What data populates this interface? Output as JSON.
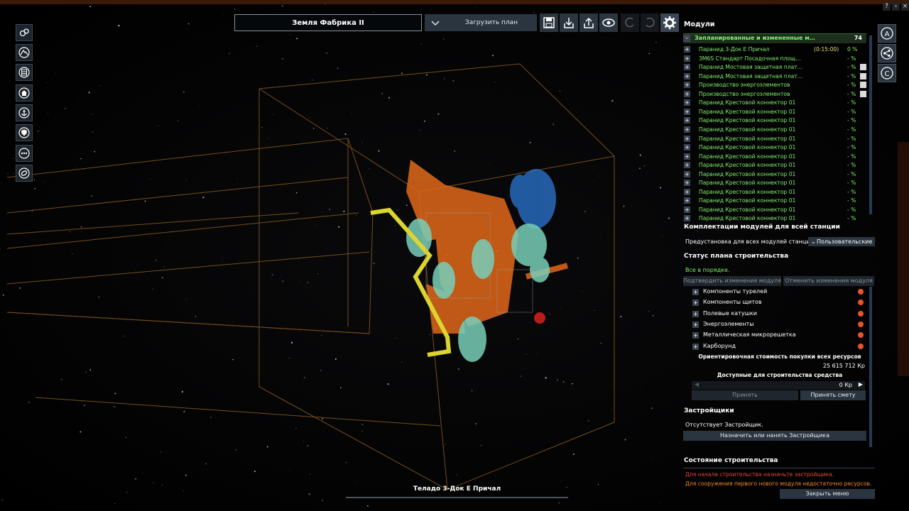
{
  "station_name": "Земля Фабрика II",
  "load_plan_label": "Загрузить план",
  "modules_title": "Модули",
  "planned_header": "Запланированные и измененные м…",
  "planned_count": "74",
  "modules": [
    {
      "name": "Паранид 3-Док Е Причал",
      "time": "(0:15:00)",
      "pct": "0 %",
      "edit": false
    },
    {
      "name": "ЗМ6S Стандарт Посадочная площ…",
      "time": "",
      "pct": "- %",
      "edit": false
    },
    {
      "name": "Паранид Мостовая защитная плат…",
      "time": "",
      "pct": "- %",
      "edit": true
    },
    {
      "name": "Паранид Мостовая защитная плат…",
      "time": "",
      "pct": "- %",
      "edit": true
    },
    {
      "name": "Производство энергоэлементов",
      "time": "",
      "pct": "- %",
      "edit": true
    },
    {
      "name": "Производство энергоэлементов",
      "time": "",
      "pct": "- %",
      "edit": true
    },
    {
      "name": "Паранид Крестовой коннектор 01",
      "time": "",
      "pct": "- %",
      "edit": false
    },
    {
      "name": "Паранид Крестовой коннектор 01",
      "time": "",
      "pct": "- %",
      "edit": false
    },
    {
      "name": "Паранид Крестовой коннектор 01",
      "time": "",
      "pct": "- %",
      "edit": false
    },
    {
      "name": "Паранид Крестовой коннектор 01",
      "time": "",
      "pct": "- %",
      "edit": false
    },
    {
      "name": "Паранид Крестовой коннектор 01",
      "time": "",
      "pct": "- %",
      "edit": false
    },
    {
      "name": "Паранид Крестовой коннектор 01",
      "time": "",
      "pct": "- %",
      "edit": false
    },
    {
      "name": "Паранид Крестовой коннектор 01",
      "time": "",
      "pct": "- %",
      "edit": false
    },
    {
      "name": "Паранид Крестовой коннектор 01",
      "time": "",
      "pct": "- %",
      "edit": false
    },
    {
      "name": "Паранид Крестовой коннектор 01",
      "time": "",
      "pct": "- %",
      "edit": false
    },
    {
      "name": "Паранид Крестовой коннектор 01",
      "time": "",
      "pct": "- %",
      "edit": false
    },
    {
      "name": "Паранид Крестовой коннектор 01",
      "time": "",
      "pct": "- %",
      "edit": false
    },
    {
      "name": "Паранид Крестовой коннектор 01",
      "time": "",
      "pct": "- %",
      "edit": false
    },
    {
      "name": "Паранид Крестовой коннектор 01",
      "time": "",
      "pct": "- %",
      "edit": false
    },
    {
      "name": "Паранид Крестовой коннектор 01",
      "time": "",
      "pct": "- %",
      "edit": false
    }
  ],
  "equipment_title": "Комплектации модулей для всей станции",
  "preset_label": "Предустановка для всех модулей станции:",
  "preset_value": "Пользовательские",
  "plan_status_title": "Статус плана строительства",
  "plan_status_text": "Все в порядке.",
  "confirm_changes": "Подтвердить изменения модуля",
  "cancel_changes": "Отменить изменения модуля",
  "resources": [
    "Компоненты турелей",
    "Компоненты щитов",
    "Полевые катушки",
    "Энергоэлементы",
    "Металлическая микрорешетка",
    "Карборунд"
  ],
  "est_cost_label": "Ориентировочная стоимость покупки всех ресурсов",
  "est_cost_value": "25 615 712 Кр",
  "funds_label": "Доступные для строительства средства",
  "funds_value": "0 Кр",
  "accept_label": "Принять",
  "accept_budget_label": "Принять смету",
  "builders_title": "Застройщики",
  "no_builder": "Отсутствует Застройщик.",
  "assign_builder": "Назначить или нанять Застройщика",
  "construction_state_title": "Состояние строительства",
  "warn1": "Для начала строительства назначьте застройщика.",
  "warn2": "Для сооружения первого нового модуля недостаточно ресурсов.",
  "close_menu": "Закрыть меню",
  "selected_module": "Теладо 3-Док Е Причал",
  "window_buttons": [
    "?",
    "‹",
    "×"
  ],
  "colors": {
    "accent_green": "#7ff06a",
    "warning_red": "#e8443a",
    "warning_orange": "#f08a2a",
    "panel_button": "#2b3540",
    "wireframe": "#b07a2a"
  }
}
